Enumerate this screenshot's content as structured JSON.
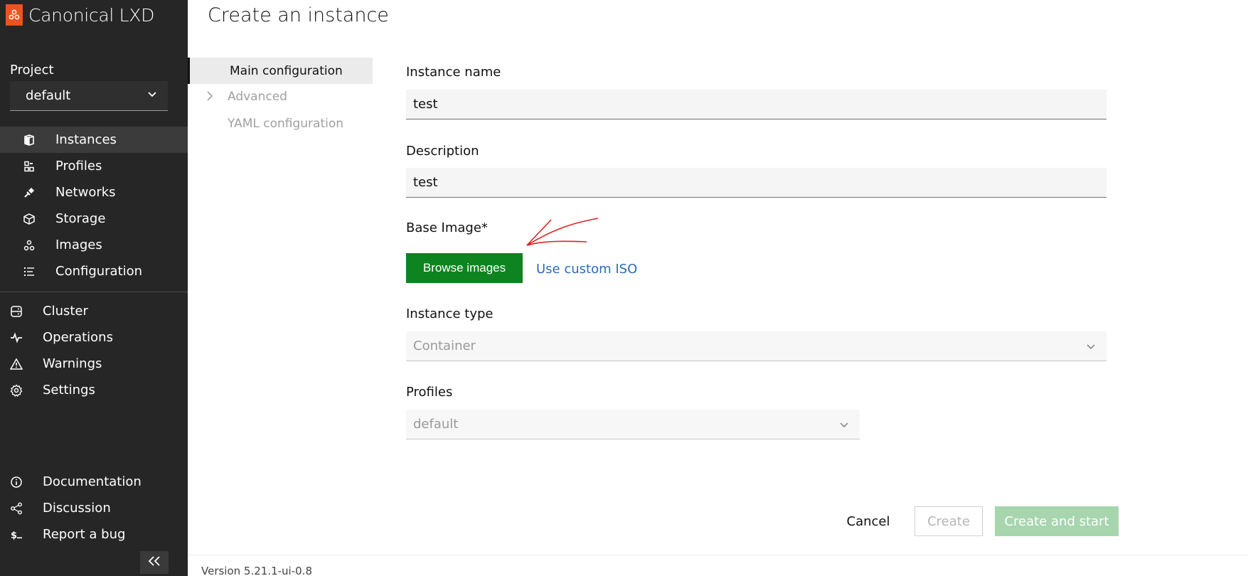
{
  "app": {
    "title": "Canonical LXD",
    "brand_color": "#e95420"
  },
  "sidebar": {
    "project_label": "Project",
    "project_value": "default",
    "primary_items": [
      {
        "label": "Instances",
        "icon": "instances-icon",
        "active": true
      },
      {
        "label": "Profiles",
        "icon": "profiles-icon"
      },
      {
        "label": "Networks",
        "icon": "networks-icon"
      },
      {
        "label": "Storage",
        "icon": "storage-icon"
      },
      {
        "label": "Images",
        "icon": "images-icon"
      },
      {
        "label": "Configuration",
        "icon": "configuration-icon"
      }
    ],
    "secondary_items": [
      {
        "label": "Cluster",
        "icon": "cluster-icon"
      },
      {
        "label": "Operations",
        "icon": "operations-icon"
      },
      {
        "label": "Warnings",
        "icon": "warning-icon"
      },
      {
        "label": "Settings",
        "icon": "gear-icon"
      }
    ],
    "footer_items": [
      {
        "label": "Documentation",
        "icon": "info-icon"
      },
      {
        "label": "Discussion",
        "icon": "share-icon"
      },
      {
        "label": "Report a bug",
        "icon": "terminal-icon"
      }
    ]
  },
  "main": {
    "title": "Create an instance",
    "tabs": [
      {
        "label": "Main configuration",
        "active": true
      },
      {
        "label": "Advanced"
      },
      {
        "label": "YAML configuration"
      }
    ],
    "form": {
      "instance_name_label": "Instance name",
      "instance_name_value": "test",
      "description_label": "Description",
      "description_value": "test",
      "base_image_label": "Base Image*",
      "browse_images_label": "Browse images",
      "custom_iso_label": "Use custom ISO",
      "instance_type_label": "Instance type",
      "instance_type_value": "Container",
      "profiles_label": "Profiles",
      "profiles_value": "default"
    },
    "actions": {
      "cancel_label": "Cancel",
      "create_label": "Create",
      "create_and_start_label": "Create and start"
    },
    "version": "Version 5.21.1-ui-0.8"
  },
  "colors": {
    "sidebar_bg": "#262626",
    "primary_button": "#0e8420",
    "link": "#2c6bb8",
    "disabled_positive": "#a7d5ae",
    "annotation": "#e02020"
  }
}
